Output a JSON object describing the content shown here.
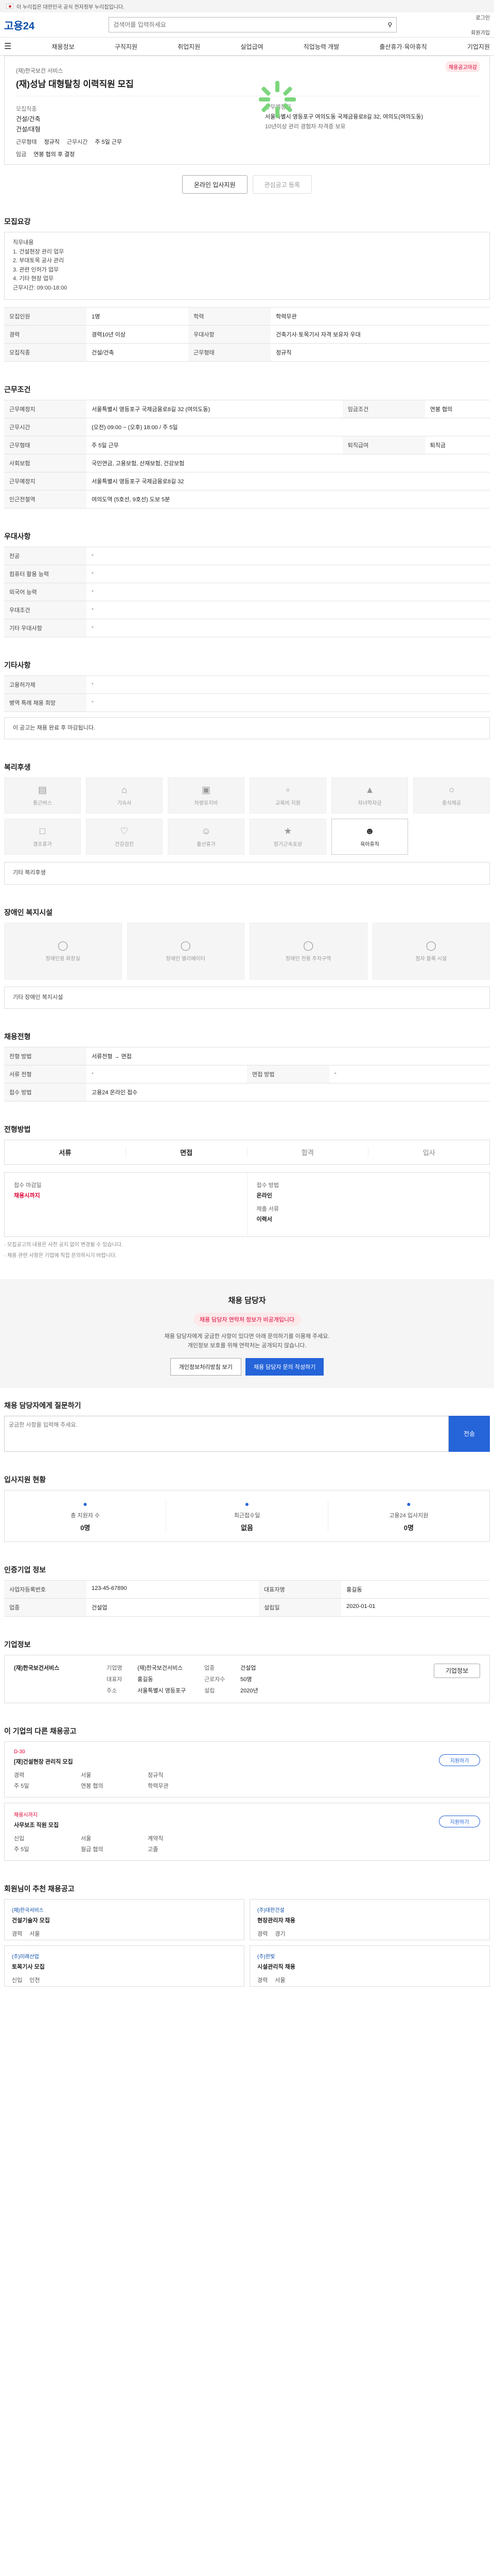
{
  "gov": {
    "text": "이 누리집은 대한민국 공식 전자정부 누리집입니다."
  },
  "header": {
    "logo": "고용24",
    "search_placeholder": "검색어를 입력하세요",
    "links": [
      "로그인",
      "회원가입"
    ]
  },
  "gnb": {
    "items": [
      "채용정보",
      "구직지원",
      "취업지원",
      "실업급여",
      "직업능력 개발",
      "출산휴가·육아휴직",
      "기업지원"
    ]
  },
  "job": {
    "badge": "채용공고마감",
    "company": "(재)한국보건 서비스",
    "title": "(재)성남 대형탈칭 이력직원 모집",
    "labels": {
      "wage": "모집직종",
      "place": "근무예정지"
    },
    "values": {
      "wage": "건설/건축",
      "place": "건설/대형",
      "desc1": "10년이상 관리 경험자·자격증 보유",
      "place_detail": "서울특별시 영등포구 여의도동 국제금융로8길 32, 여의도(여의도동)",
      "term": "2년",
      "welfare": "주 4일 근무"
    },
    "employ": [
      "근무형태",
      "정규직",
      "근무시간",
      "주 5일 근무"
    ],
    "salary": {
      "label": "임금",
      "value": "연봉 협의 후 결정"
    }
  },
  "buttons": {
    "apply": "온라인 입사지원",
    "scrap": "관심공고 등록"
  },
  "sec1": {
    "title": "모집요강",
    "text": "직무내용\n1. 건설현장 관리 업무\n2. 부대토목 공사 관리\n3. 관련 인허가 업무\n4. 기타 현장 업무\n근무시간: 09:00-18:00"
  },
  "sec1_rows": [
    [
      "모집인원",
      "1명"
    ],
    [
      "학력",
      "학력무관"
    ],
    [
      "경력",
      "경력10년 이상"
    ],
    [
      "우대사항",
      "건축기사·토목기사 자격 보유자 우대"
    ],
    [
      "모집직종",
      "건설/건축"
    ],
    [
      "근무형태",
      "정규직"
    ]
  ],
  "sec2": {
    "title": "근무조건"
  },
  "sec2_rows": [
    [
      "근무예정지",
      "서울특별시 영등포구 국제금융로8길 32 (여의도동)"
    ],
    [
      "임금조건",
      "연봉 협의"
    ],
    [
      "근무시간",
      "(오전) 09:00 ~ (오후) 18:00 / 주 5일"
    ],
    [
      "근무형태",
      "주 5일 근무"
    ],
    [
      "사회보험",
      "국민연금, 고용보험, 산재보험, 건강보험"
    ],
    [
      "퇴직급여",
      "퇴직금"
    ],
    [
      "근무예정지",
      "서울특별시 영등포구 국제금융로8길 32"
    ],
    [
      "인근전철역",
      "여의도역 (5호선, 9호선) 도보 5분"
    ]
  ],
  "sec3": {
    "title": "우대사항"
  },
  "sec3_rows": [
    [
      "전공",
      "-"
    ],
    [
      "컴퓨터 활용 능력",
      "-"
    ],
    [
      "외국어 능력",
      "-"
    ],
    [
      "우대조건",
      "-"
    ],
    [
      "기타 우대사항",
      "-"
    ]
  ],
  "sec4": {
    "title": "기타사항"
  },
  "sec4_rows": [
    [
      "고용허가제",
      "-"
    ],
    [
      "병역 특례 채용 희망",
      "-"
    ]
  ],
  "sec4_box": "이 공고는 채용 완료 후 마감됩니다.",
  "sec5": {
    "title": "복리후생"
  },
  "welfare_tiles": [
    "통근버스",
    "기숙사",
    "차량유지비",
    "교육비 지원",
    "자녀학자금",
    "중식제공",
    "경조휴가",
    "건강검진",
    "출산휴가",
    "장기근속포상",
    "육아휴직",
    "퇴직금지원"
  ],
  "sec5_box": "기타 복리후생",
  "sec6": {
    "title": "장애인 복지시설"
  },
  "access_tiles": [
    "장애인용 화장실",
    "장애인 엘리베이터",
    "장애인 전용 주차구역",
    "점자 블록 시설"
  ],
  "sec6_box": "기타 장애인 복지시설",
  "sec7": {
    "title": "채용전형"
  },
  "sec7_rows": [
    [
      "전형 방법",
      "서류전형 → 면접"
    ],
    [
      "서류 전형",
      "-"
    ],
    [
      "면접 방법",
      "-"
    ],
    [
      "접수 방법",
      "고용24 온라인 접수"
    ]
  ],
  "sec8": {
    "title": "전형방법"
  },
  "steps": [
    "서류",
    "면접",
    "합격",
    "입사"
  ],
  "apply_info": [
    [
      "접수 마감일",
      "채용시까지"
    ],
    [
      "접수 방법",
      "온라인"
    ],
    [
      "제출 서류",
      "이력서"
    ]
  ],
  "notes": [
    "· 모집공고의 내용은 사전 공지 없이 변경될 수 있습니다.",
    "· 채용 관련 사항은 기업에 직접 문의하시기 바랍니다."
  ],
  "contact": {
    "title": "채용 담당자",
    "pink": "채용 담당자 연락처 정보가 비공개입니다",
    "line1": "채용 담당자에게 궁금한 사항이 있다면 아래 문의하기를 이용해 주세요.",
    "line2": "개인정보 보호를 위해 연락처는 공개되지 않습니다.",
    "b1": "개인정보처리방침 보기",
    "b2": "채용 담당자 문의 작성하기"
  },
  "qa": {
    "title": "채용 담당자에게 질문하기",
    "placeholder": "궁금한 사항을 입력해 주세요.",
    "send": "전송"
  },
  "stats": {
    "title": "입사지원 현황",
    "items": [
      [
        "총 지원자 수",
        "0명"
      ],
      [
        "최근접수일",
        "없음"
      ],
      [
        "고용24 입사지원",
        "0명"
      ]
    ]
  },
  "sec9": {
    "title": "인증기업 정보"
  },
  "sec9_rows": [
    [
      "사업자등록번호",
      "123-45-67890"
    ],
    [
      "대표자명",
      "홍길동"
    ],
    [
      "업종",
      "건설업"
    ],
    [
      "설립일",
      "2020-01-01"
    ]
  ],
  "ent": {
    "title": "기업정보",
    "name": "(재)한국보건서비스",
    "rows": [
      [
        "기업명",
        "(재)한국보건서비스"
      ],
      [
        "업종",
        "건설업"
      ],
      [
        "대표자",
        "홍길동"
      ],
      [
        "근로자수",
        "50명"
      ],
      [
        "주소",
        "서울특별시 영등포구"
      ],
      [
        "설립",
        "2020년"
      ]
    ],
    "btn": "기업정보"
  },
  "cards_title": "이 기업의 다른 채용공고",
  "cards": [
    {
      "tag": "D-30",
      "title": "[재]건설현장 관리직 모집",
      "meta": [
        "경력",
        "서울",
        "정규직",
        "주 5일",
        "연봉 협의",
        "학력무관"
      ],
      "side": "지원하기"
    },
    {
      "tag": "채용시까지",
      "title": "사무보조 직원 모집",
      "meta": [
        "신입",
        "서울",
        "계약직",
        "주 5일",
        "월급 협의",
        "고졸"
      ],
      "side": "지원하기"
    }
  ],
  "rec_title": "회원님이 추천 채용공고",
  "rec": [
    {
      "c": "(재)한국서비스",
      "t": "건설기술자 모집",
      "m": [
        "경력",
        "서울"
      ]
    },
    {
      "c": "(주)대한건설",
      "t": "현장관리자 채용",
      "m": [
        "경력",
        "경기"
      ]
    },
    {
      "c": "(주)미래산업",
      "t": "토목기사 모집",
      "m": [
        "신입",
        "인천"
      ]
    },
    {
      "c": "(주)한빛",
      "t": "시설관리직 채용",
      "m": [
        "경력",
        "서울"
      ]
    }
  ]
}
